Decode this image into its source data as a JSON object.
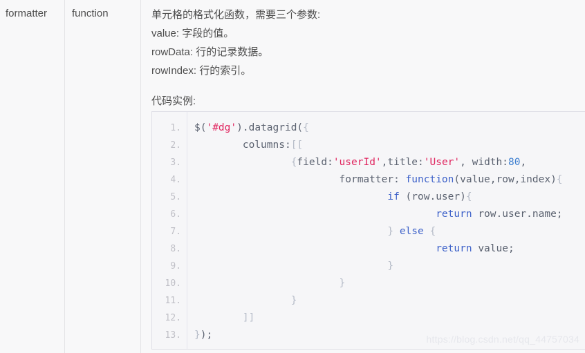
{
  "row": {
    "property_name": "formatter",
    "property_type": "function",
    "description_lines": [
      "单元格的格式化函数，需要三个参数:",
      "value: 字段的值。",
      "rowData: 行的记录数据。",
      "rowIndex: 行的索引。"
    ],
    "code_label": "代码实例:"
  },
  "code": {
    "line_numbers": [
      "1.",
      "2.",
      "3.",
      "4.",
      "5.",
      "6.",
      "7.",
      "8.",
      "9.",
      "10.",
      "11.",
      "12.",
      "13."
    ],
    "lines": [
      "$('#dg').datagrid({",
      "        columns:[[",
      "                {field:'userId',title:'User', width:80,",
      "                        formatter: function(value,row,index){",
      "                                if (row.user){",
      "                                        return row.user.name;",
      "                                } else {",
      "                                        return value;",
      "                                }",
      "                        }",
      "                }",
      "        ]]",
      "});"
    ],
    "plain_text": "$('#dg').datagrid({\n        columns:[[\n                {field:'userId',title:'User', width:80,\n                        formatter: function(value,row,index){\n                                if (row.user){\n                                        return row.user.name;\n                                } else {\n                                        return value;\n                                }\n                        }\n                }\n        ]]\n});",
    "language": "javascript",
    "strings": [
      "'#dg'",
      "'userId'",
      "'User'"
    ],
    "keywords": [
      "function",
      "if",
      "else",
      "return"
    ],
    "numbers": [
      "80"
    ]
  },
  "watermark": {
    "text": "https://blog.csdn.net/qq_44757034"
  },
  "colors": {
    "page_background": "#f8f8f9",
    "code_background": "#f6f6f8",
    "code_border": "#dfdfe6",
    "text": "#4d4d4d",
    "code_text": "#5b6270",
    "gutter_text": "#bfbfc6",
    "string_token": "#e0245e",
    "keyword_token": "#3e62c9",
    "number_token": "#3e7fd0",
    "divider": "#e3e3e6",
    "watermark": "#e6e7ec"
  }
}
